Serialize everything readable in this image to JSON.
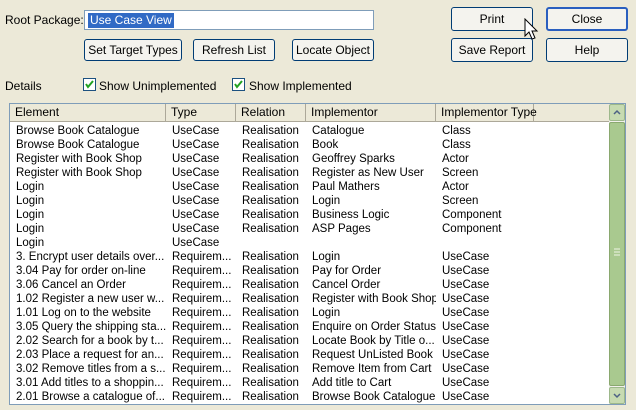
{
  "root_package": {
    "label": "Root Package:",
    "value": "Use Case View"
  },
  "buttons": {
    "print": "Print",
    "close": "Close",
    "set_target_types": "Set Target Types",
    "refresh_list": "Refresh List",
    "locate_object": "Locate Object",
    "save_report": "Save Report",
    "help": "Help"
  },
  "details_label": "Details",
  "checkboxes": {
    "show_unimplemented": {
      "label": "Show Unimplemented",
      "checked": true
    },
    "show_implemented": {
      "label": "Show Implemented",
      "checked": true
    }
  },
  "table": {
    "columns": [
      "Element",
      "Type",
      "Relation",
      "Implementor",
      "Implementor Type"
    ],
    "rows": [
      [
        "Browse Book Catalogue",
        "UseCase",
        "Realisation",
        "Catalogue",
        "Class"
      ],
      [
        "Browse Book Catalogue",
        "UseCase",
        "Realisation",
        "Book",
        "Class"
      ],
      [
        "Register with Book Shop",
        "UseCase",
        "Realisation",
        "Geoffrey Sparks",
        "Actor"
      ],
      [
        "Register with Book Shop",
        "UseCase",
        "Realisation",
        "Register as New User",
        "Screen"
      ],
      [
        "Login",
        "UseCase",
        "Realisation",
        "Paul Mathers",
        "Actor"
      ],
      [
        "Login",
        "UseCase",
        "Realisation",
        "Login",
        "Screen"
      ],
      [
        "Login",
        "UseCase",
        "Realisation",
        "Business Logic",
        "Component"
      ],
      [
        "Login",
        "UseCase",
        "Realisation",
        "ASP Pages",
        "Component"
      ],
      [
        "Login",
        "UseCase",
        "",
        "",
        ""
      ],
      [
        "3. Encrypt user details over...",
        "Requirem...",
        "Realisation",
        "Login",
        "UseCase"
      ],
      [
        "3.04 Pay for order on-line",
        "Requirem...",
        "Realisation",
        "Pay for Order",
        "UseCase"
      ],
      [
        "3.06 Cancel an Order",
        "Requirem...",
        "Realisation",
        "Cancel Order",
        "UseCase"
      ],
      [
        "1.02 Register a new user w...",
        "Requirem...",
        "Realisation",
        "Register with Book Shop",
        "UseCase"
      ],
      [
        "1.01 Log on to the website",
        "Requirem...",
        "Realisation",
        "Login",
        "UseCase"
      ],
      [
        "3.05 Query the shipping sta...",
        "Requirem...",
        "Realisation",
        "Enquire on Order Status",
        "UseCase"
      ],
      [
        "2.02 Search for a book by t...",
        "Requirem...",
        "Realisation",
        "Locate Book by Title o...",
        "UseCase"
      ],
      [
        "2.03 Place a request for an...",
        "Requirem...",
        "Realisation",
        "Request UnListed Book",
        "UseCase"
      ],
      [
        "3.02 Remove titles from a s...",
        "Requirem...",
        "Realisation",
        "Remove Item from Cart",
        "UseCase"
      ],
      [
        "3.01 Add titles to a shoppin...",
        "Requirem...",
        "Realisation",
        "Add title to Cart",
        "UseCase"
      ],
      [
        "2.01 Browse a catalogue of...",
        "Requirem...",
        "Realisation",
        "Browse Book Catalogue",
        "UseCase"
      ]
    ]
  },
  "icons": {
    "checkbox": "checkmark-icon",
    "scroll_up": "scroll-up-arrow-icon",
    "scroll_down": "scroll-down-arrow-icon",
    "cursor": "mouse-pointer-icon"
  }
}
